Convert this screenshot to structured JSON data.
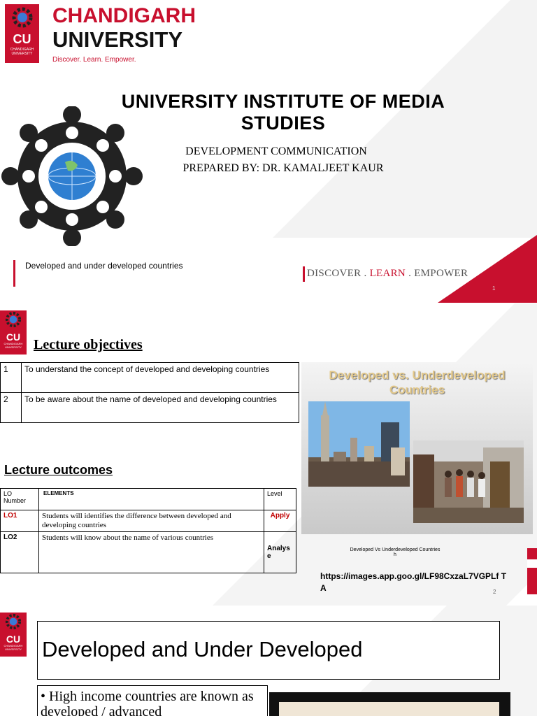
{
  "logo": {
    "abbr": "CU",
    "small_name": "CHANDIGARH UNIVERSITY",
    "name_line1": "CHANDIGARH",
    "name_line2": "UNIVERSITY",
    "tagline": "Discover. Learn. Empower."
  },
  "slide1": {
    "institute": "UNIVERSITY INSTITUTE OF MEDIA STUDIES",
    "course": "DEVELOPMENT COMMUNICATION",
    "prepared_by": "PREPARED BY: DR. KAMALJEET KAUR",
    "topic": "Developed and under developed countries",
    "motto": {
      "part1": "DISCOVER . ",
      "part2": "LEARN",
      "part3": " . EMPOWER"
    },
    "page": "1"
  },
  "slide2": {
    "objectives_heading": "Lecture objectives",
    "objectives": [
      {
        "num": "1",
        "text": "To understand the concept of developed and developing countries"
      },
      {
        "num": "2",
        "text": "To be aware about the name of developed and developing countries"
      }
    ],
    "outcomes_heading": "Lecture outcomes",
    "outcomes_header": {
      "lo": "LO Number",
      "elements": "ELEMENTS",
      "level": "Level"
    },
    "outcomes": [
      {
        "lo": "LO1",
        "text": "Students will identifies the difference between developed and developing countries",
        "level": "Apply"
      },
      {
        "lo": "LO2",
        "text": "Students will know about the name of various countries",
        "level": "Analys e"
      }
    ],
    "image_title": "Developed vs. Underdeveloped Countries",
    "image_caption": "Developed Vs Underdeveloped Countries",
    "image_caption_sub": "h",
    "link": "https://images.app.goo.gl/LF98CxzaL7VGPLf TA",
    "page": "2",
    "colors": {
      "lo1": "#c00000",
      "apply": "#c00000"
    }
  },
  "slide3": {
    "title": "Developed and Under Developed",
    "bullet": "• High income countries are known as developed / advanced"
  }
}
